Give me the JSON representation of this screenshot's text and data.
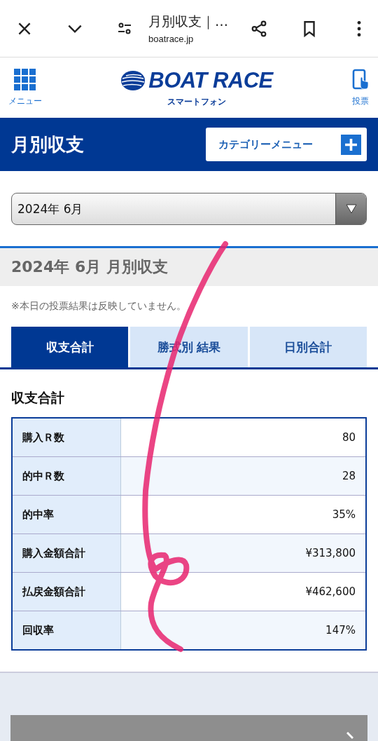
{
  "browser": {
    "title": "月別収支｜…",
    "url": "boatrace.jp"
  },
  "header": {
    "menu_label": "メニュー",
    "logo_text": "BOAT RACE",
    "logo_sub": "スマートフォン",
    "vote_label": "投票"
  },
  "page_title": "月別収支",
  "category_button": "カテゴリーメニュー",
  "month_select": {
    "value": "2024年 6月"
  },
  "section_title": "2024年 6月 月別収支",
  "note": "※本日の投票結果は反映していません。",
  "tabs": [
    {
      "label": "収支合計",
      "selected": true
    },
    {
      "label": "勝式別 結果",
      "selected": false
    },
    {
      "label": "日別合計",
      "selected": false
    }
  ],
  "summary_title": "収支合計",
  "rows": [
    {
      "label": "購入Ｒ数",
      "value": "80"
    },
    {
      "label": "的中Ｒ数",
      "value": "28"
    },
    {
      "label": "的中率",
      "value": "35%"
    },
    {
      "label": "購入金額合計",
      "value": "¥313,800"
    },
    {
      "label": "払戻金額合計",
      "value": "¥462,600"
    },
    {
      "label": "回収率",
      "value": "147%"
    }
  ]
}
